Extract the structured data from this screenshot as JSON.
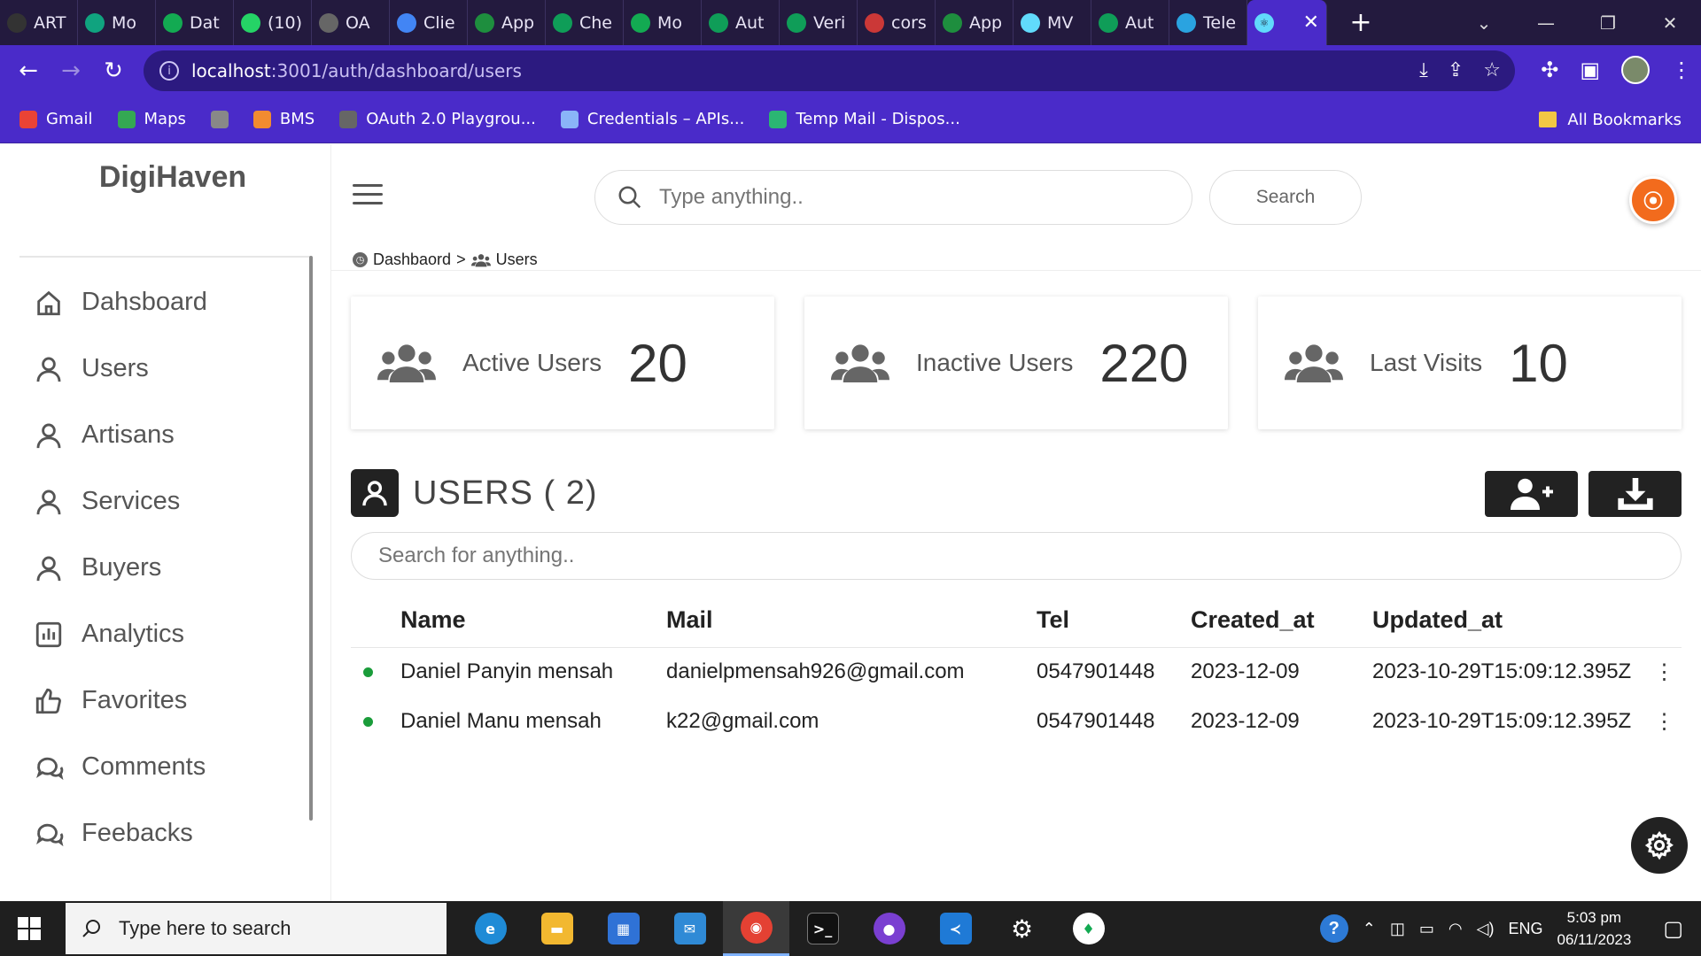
{
  "browser": {
    "tabs": [
      {
        "label": "ART",
        "icon": "github-icon",
        "color": "#333333"
      },
      {
        "label": "Mo",
        "icon": "openai-icon",
        "color": "#10a37f"
      },
      {
        "label": "Dat",
        "icon": "mongodb-leaf-icon",
        "color": "#13aa52"
      },
      {
        "label": "(10)",
        "icon": "whatsapp-icon",
        "color": "#25d366"
      },
      {
        "label": "OA",
        "icon": "oauth-icon",
        "color": "#666666"
      },
      {
        "label": "Clie",
        "icon": "api-icon",
        "color": "#4285f4"
      },
      {
        "label": "App",
        "icon": "check-icon",
        "color": "#1e8e3e"
      },
      {
        "label": "Che",
        "icon": "doc-icon",
        "color": "#0f9d58"
      },
      {
        "label": "Mo",
        "icon": "mongodb-leaf-icon",
        "color": "#13aa52"
      },
      {
        "label": "Aut",
        "icon": "doc-icon",
        "color": "#0f9d58"
      },
      {
        "label": "Veri",
        "icon": "doc-icon",
        "color": "#0f9d58"
      },
      {
        "label": "cors",
        "icon": "npm-icon",
        "color": "#cb3837"
      },
      {
        "label": "App",
        "icon": "check-icon",
        "color": "#1e8e3e"
      },
      {
        "label": "MV",
        "icon": "react-icon",
        "color": "#61dafb"
      },
      {
        "label": "Aut",
        "icon": "doc-icon",
        "color": "#0f9d58"
      },
      {
        "label": "Tele",
        "icon": "telegram-icon",
        "color": "#2aa3e0"
      }
    ],
    "url_host": "localhost",
    "url_rest": ":3001/auth/dashboard/users",
    "bookmarks": [
      {
        "label": "Gmail",
        "icon": "gmail-icon",
        "color": "#ea4335"
      },
      {
        "label": "Maps",
        "icon": "maps-icon",
        "color": "#34a853"
      },
      {
        "label": "",
        "icon": "globe-icon",
        "color": "#888888"
      },
      {
        "label": "BMS",
        "icon": "bms-icon",
        "color": "#f28b30"
      },
      {
        "label": "OAuth 2.0 Playgrou...",
        "icon": "oauth-icon",
        "color": "#666666"
      },
      {
        "label": "Credentials – APIs...",
        "icon": "api-icon",
        "color": "#8ab4f8"
      },
      {
        "label": "Temp Mail - Dispos...",
        "icon": "tempmail-icon",
        "color": "#2bb673"
      }
    ],
    "all_bookmarks": "All Bookmarks"
  },
  "app": {
    "brand": "DigiHaven",
    "sidebar": [
      {
        "label": "Dahsboard",
        "icon": "home-icon"
      },
      {
        "label": "Users",
        "icon": "user-icon"
      },
      {
        "label": "Artisans",
        "icon": "user-icon"
      },
      {
        "label": "Services",
        "icon": "user-icon"
      },
      {
        "label": "Buyers",
        "icon": "user-icon"
      },
      {
        "label": "Analytics",
        "icon": "analytics-icon"
      },
      {
        "label": "Favorites",
        "icon": "thumbs-up-icon"
      },
      {
        "label": "Comments",
        "icon": "comments-icon"
      },
      {
        "label": "Feebacks",
        "icon": "comments-icon"
      }
    ],
    "top_search": {
      "placeholder": "Type anything..",
      "button": "Search"
    },
    "breadcrumb": {
      "home": "Dashbaord",
      "separator": ">",
      "current": "Users"
    },
    "stats": [
      {
        "label": "Active Users",
        "value": "20"
      },
      {
        "label": "Inactive Users",
        "value": "220"
      },
      {
        "label": "Last Visits",
        "value": "10"
      }
    ],
    "users_title": "USERS ( 2)",
    "table_search_placeholder": "Search for anything..",
    "table": {
      "columns": [
        "Name",
        "Mail",
        "Tel",
        "Created_at",
        "Updated_at"
      ],
      "rows": [
        {
          "name": "Daniel Panyin mensah",
          "mail": "danielpmensah926@gmail.com",
          "tel": "0547901448",
          "created": "2023-12-09",
          "updated": "2023-10-29T15:09:12.395Z",
          "status_color": "#1a9c3a"
        },
        {
          "name": "Daniel Manu mensah",
          "mail": "k22@gmail.com",
          "tel": "0547901448",
          "created": "2023-12-09",
          "updated": "2023-10-29T15:09:12.395Z",
          "status_color": "#1a9c3a"
        }
      ],
      "row_menu": "⋮"
    }
  },
  "taskbar": {
    "search_placeholder": "Type here to search",
    "language": "ENG",
    "time": "5:03 pm",
    "date": "06/11/2023"
  }
}
